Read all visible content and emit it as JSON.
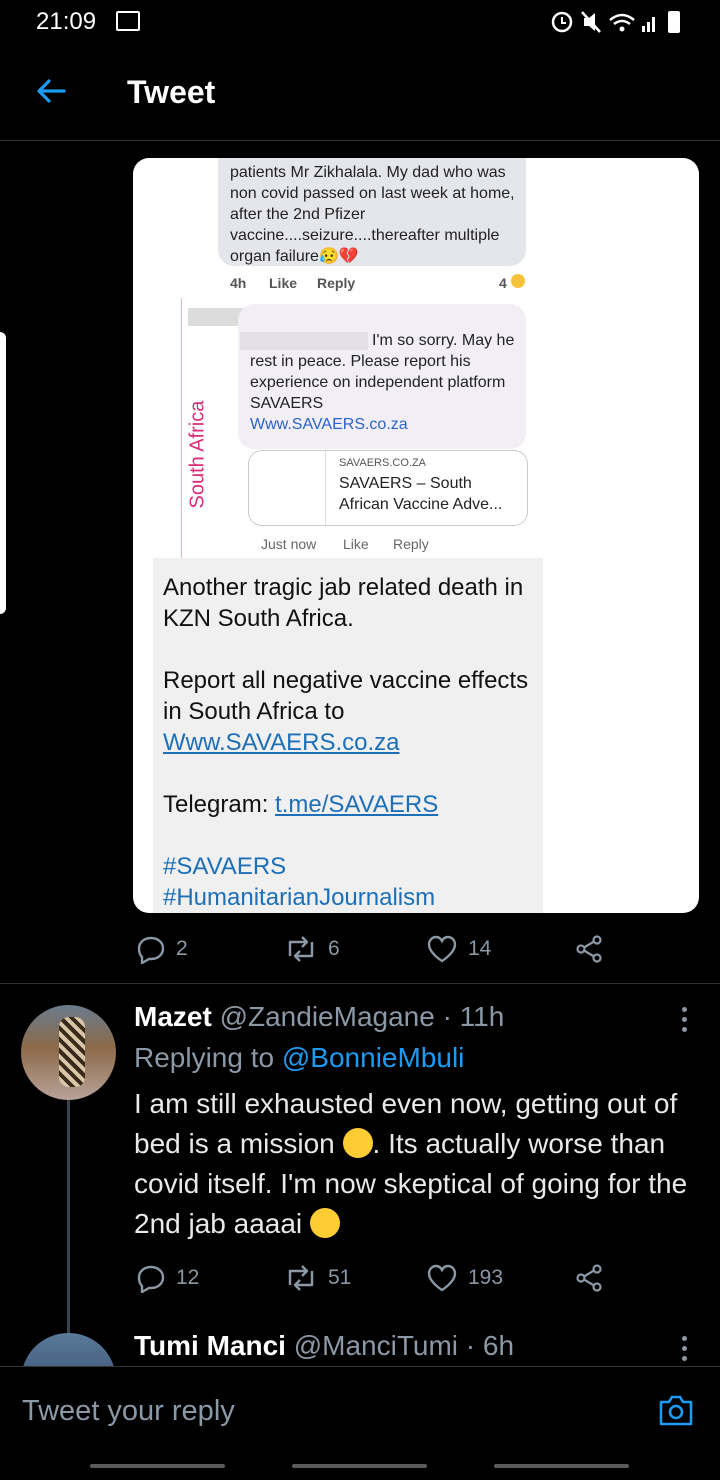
{
  "status_bar": {
    "time": "21:09",
    "icons": [
      "gallery-icon",
      "alarm-icon",
      "mute-icon",
      "wifi-icon",
      "signal-icon",
      "battery-icon"
    ]
  },
  "header": {
    "title": "Tweet",
    "back_icon": "arrow-left-icon"
  },
  "embedded_image": {
    "comment1_text": "patients Mr Zikhalala.  My dad who was non covid passed on last week at home, after the 2nd Pfizer vaccine....seizure....thereafter multiple organ failure😥💔",
    "comment1_meta": {
      "time": "4h",
      "like": "Like",
      "reply": "Reply",
      "reactions": "4"
    },
    "page_vertical_label": "South Africa",
    "comment2_text": "I'm so sorry. May he rest in peace. Please report his experience on independent platform SAVAERS",
    "comment2_link": "Www.SAVAERS.co.za",
    "preview_domain": "SAVAERS.CO.ZA",
    "preview_title": "SAVAERS – South African Vaccine Adve...",
    "comment2_meta": {
      "time": "Just now",
      "like": "Like",
      "reply": "Reply"
    },
    "caption": {
      "line1": "Another tragic jab related death in KZN South Africa.",
      "line2": "Report all negative vaccine effects in South Africa to",
      "link1": "Www.SAVAERS.co.za",
      "telegram_label": "Telegram: ",
      "telegram_link": "t.me/SAVAERS",
      "hashtag1": "#SAVAERS",
      "hashtag2": "#HumanitarianJournalism"
    }
  },
  "main_tweet_actions": {
    "replies": "2",
    "retweets": "6",
    "likes": "14"
  },
  "reply1": {
    "name": "Mazet",
    "handle": "@ZandieMagane · 11h",
    "replying_prefix": "Replying to ",
    "replying_to": "@BonnieMbuli",
    "text_part1": "I am still exhausted even now, getting out of bed is a mission ",
    "text_part2": ". Its actually worse than covid itself. I'm now skeptical of going for the 2nd jab aaaai ",
    "replies": "12",
    "retweets": "51",
    "likes": "193"
  },
  "reply2": {
    "name": "Tumi Manci",
    "handle": "@ManciTumi · 6h"
  },
  "compose": {
    "placeholder": "Tweet your reply",
    "camera_icon": "camera-icon"
  },
  "colors": {
    "background": "#000000",
    "accent": "#1d9bf0",
    "muted": "#8b98a5"
  }
}
